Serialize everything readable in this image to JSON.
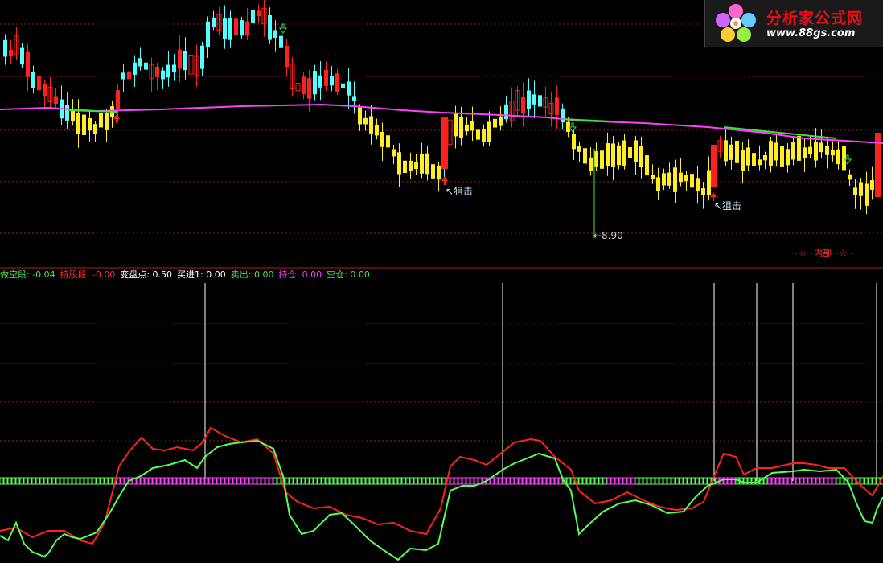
{
  "badge": {
    "title": "分析家公式网",
    "url": "www.88gs.com"
  },
  "legend": [
    {
      "label": "做空段:",
      "value": "-0.04",
      "color": "#55dd55"
    },
    {
      "label": "持股段:",
      "value": "-0.00",
      "color": "#ff3030"
    },
    {
      "label": "变盘点:",
      "value": "0.50",
      "color": "#ffffff"
    },
    {
      "label": "买进1:",
      "value": "0.00",
      "color": "#ffffff"
    },
    {
      "label": "卖出:",
      "value": "0.00",
      "color": "#55dd55"
    },
    {
      "label": "持仓:",
      "value": "0.00",
      "color": "#ff40ff"
    },
    {
      "label": "空仓:",
      "value": "0.00",
      "color": "#55dd55"
    }
  ],
  "annotations": {
    "snipe1": "↖狙击",
    "snipe2": "↖狙击",
    "low": "←8.90",
    "inner": "~☆~内部~☆~"
  },
  "colors": {
    "bg": "#000000",
    "up": "#ff2020",
    "down": "#54ffff",
    "yellow": "#ffee22",
    "ma": "#ff40ff",
    "ma_green": "#40e040",
    "signal_red": "#ff2020",
    "signal_green": "#55ff55",
    "grid": "#8b2020",
    "pink": "#ff40ff"
  },
  "chart_data": {
    "type": "candlestick",
    "upper_marks": {
      "up_arrows": [
        145,
        553,
        887
      ],
      "down_arrows": [
        352,
        712,
        1054
      ]
    },
    "vertical_lines": [
      255,
      625,
      888,
      941,
      986,
      1090
    ],
    "indicator_series": [
      {
        "color": "red",
        "values": [
          [
            0,
            660
          ],
          [
            20,
            656
          ],
          [
            40,
            668
          ],
          [
            60,
            660
          ],
          [
            80,
            660
          ],
          [
            100,
            672
          ],
          [
            115,
            676
          ],
          [
            130,
            650
          ],
          [
            148,
            580
          ],
          [
            160,
            562
          ],
          [
            176,
            544
          ],
          [
            190,
            558
          ],
          [
            205,
            560
          ],
          [
            220,
            556
          ],
          [
            240,
            560
          ],
          [
            252,
            550
          ],
          [
            262,
            532
          ],
          [
            280,
            542
          ],
          [
            300,
            550
          ],
          [
            320,
            546
          ],
          [
            340,
            564
          ],
          [
            355,
            612
          ],
          [
            370,
            624
          ],
          [
            390,
            632
          ],
          [
            410,
            630
          ],
          [
            430,
            640
          ],
          [
            450,
            644
          ],
          [
            470,
            652
          ],
          [
            490,
            650
          ],
          [
            510,
            660
          ],
          [
            530,
            664
          ],
          [
            548,
            632
          ],
          [
            560,
            580
          ],
          [
            572,
            568
          ],
          [
            590,
            572
          ],
          [
            605,
            578
          ],
          [
            620,
            566
          ],
          [
            640,
            550
          ],
          [
            660,
            546
          ],
          [
            672,
            548
          ],
          [
            690,
            568
          ],
          [
            710,
            584
          ],
          [
            720,
            610
          ],
          [
            740,
            626
          ],
          [
            760,
            622
          ],
          [
            780,
            612
          ],
          [
            800,
            622
          ],
          [
            820,
            630
          ],
          [
            840,
            634
          ],
          [
            860,
            632
          ],
          [
            875,
            624
          ],
          [
            888,
            592
          ],
          [
            900,
            564
          ],
          [
            915,
            568
          ],
          [
            925,
            590
          ],
          [
            941,
            582
          ],
          [
            960,
            582
          ],
          [
            986,
            576
          ],
          [
            1000,
            576
          ],
          [
            1015,
            578
          ],
          [
            1030,
            582
          ],
          [
            1050,
            582
          ],
          [
            1065,
            598
          ],
          [
            1075,
            608
          ],
          [
            1085,
            616
          ],
          [
            1098,
            592
          ]
        ]
      },
      {
        "color": "green",
        "values": [
          [
            0,
            666
          ],
          [
            10,
            672
          ],
          [
            20,
            650
          ],
          [
            30,
            676
          ],
          [
            40,
            686
          ],
          [
            55,
            692
          ],
          [
            60,
            688
          ],
          [
            70,
            672
          ],
          [
            80,
            664
          ],
          [
            90,
            668
          ],
          [
            100,
            670
          ],
          [
            120,
            662
          ],
          [
            135,
            640
          ],
          [
            150,
            614
          ],
          [
            160,
            598
          ],
          [
            175,
            592
          ],
          [
            190,
            582
          ],
          [
            210,
            578
          ],
          [
            230,
            572
          ],
          [
            245,
            582
          ],
          [
            255,
            568
          ],
          [
            270,
            556
          ],
          [
            285,
            552
          ],
          [
            300,
            550
          ],
          [
            320,
            548
          ],
          [
            340,
            558
          ],
          [
            352,
            592
          ],
          [
            360,
            640
          ],
          [
            375,
            664
          ],
          [
            390,
            660
          ],
          [
            410,
            640
          ],
          [
            425,
            638
          ],
          [
            440,
            652
          ],
          [
            460,
            672
          ],
          [
            480,
            686
          ],
          [
            495,
            696
          ],
          [
            510,
            682
          ],
          [
            530,
            684
          ],
          [
            545,
            676
          ],
          [
            560,
            610
          ],
          [
            575,
            604
          ],
          [
            590,
            604
          ],
          [
            605,
            598
          ],
          [
            625,
            584
          ],
          [
            640,
            576
          ],
          [
            655,
            570
          ],
          [
            670,
            564
          ],
          [
            690,
            570
          ],
          [
            700,
            596
          ],
          [
            710,
            610
          ],
          [
            720,
            664
          ],
          [
            730,
            654
          ],
          [
            750,
            636
          ],
          [
            770,
            626
          ],
          [
            790,
            622
          ],
          [
            810,
            628
          ],
          [
            830,
            638
          ],
          [
            850,
            636
          ],
          [
            865,
            618
          ],
          [
            880,
            604
          ],
          [
            900,
            596
          ],
          [
            915,
            596
          ],
          [
            925,
            600
          ],
          [
            941,
            600
          ],
          [
            960,
            588
          ],
          [
            986,
            586
          ],
          [
            1000,
            584
          ],
          [
            1020,
            586
          ],
          [
            1040,
            584
          ],
          [
            1055,
            600
          ],
          [
            1065,
            626
          ],
          [
            1075,
            648
          ],
          [
            1085,
            650
          ],
          [
            1090,
            634
          ],
          [
            1098,
            618
          ]
        ]
      }
    ],
    "band": {
      "pink_ranges": [
        [
          145,
          340
        ],
        [
          553,
          700
        ],
        [
          752,
          788
        ],
        [
          887,
          912
        ],
        [
          952,
          1040
        ]
      ]
    }
  }
}
